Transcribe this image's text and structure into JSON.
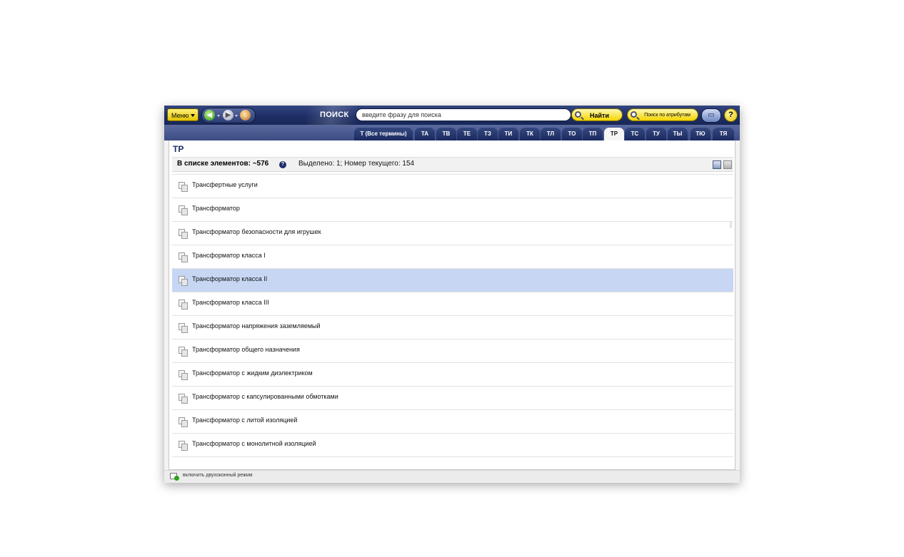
{
  "toolbar": {
    "menu_label": "Меню",
    "search_label": "ПОИСК",
    "search_placeholder": "введите фразу для поиска",
    "find_label": "Найти",
    "attr_search_label": "Поиск по атрибутам",
    "help_label": "?"
  },
  "tabs": [
    {
      "label": "Т (Все термины)",
      "active": false
    },
    {
      "label": "ТА",
      "active": false
    },
    {
      "label": "ТВ",
      "active": false
    },
    {
      "label": "ТЕ",
      "active": false
    },
    {
      "label": "ТЗ",
      "active": false
    },
    {
      "label": "ТИ",
      "active": false
    },
    {
      "label": "ТК",
      "active": false
    },
    {
      "label": "ТЛ",
      "active": false
    },
    {
      "label": "ТО",
      "active": false
    },
    {
      "label": "ТП",
      "active": false
    },
    {
      "label": "ТР",
      "active": true
    },
    {
      "label": "ТС",
      "active": false
    },
    {
      "label": "ТУ",
      "active": false
    },
    {
      "label": "ТЫ",
      "active": false
    },
    {
      "label": "ТЮ",
      "active": false
    },
    {
      "label": "ТЯ",
      "active": false
    }
  ],
  "list": {
    "title": "ТР",
    "count_text": "В списке элементов: ~576",
    "selection_text": "Выделено: 1; Номер текущего: 154",
    "items": [
      {
        "label": "Трансфертные услуги",
        "selected": false
      },
      {
        "label": "Трансформатор",
        "selected": false
      },
      {
        "label": "Трансформатор безопасности для игрушек",
        "selected": false
      },
      {
        "label": "Трансформатор класса I",
        "selected": false
      },
      {
        "label": "Трансформатор класса II",
        "selected": true
      },
      {
        "label": "Трансформатор класса III",
        "selected": false
      },
      {
        "label": "Трансформатор напряжения заземляемый",
        "selected": false
      },
      {
        "label": "Трансформатор общего назначения",
        "selected": false
      },
      {
        "label": "Трансформатор с жидким диэлектриком",
        "selected": false
      },
      {
        "label": "Трансформатор с капсулированными обмотками",
        "selected": false
      },
      {
        "label": "Трансформатор с литой изоляцией",
        "selected": false
      },
      {
        "label": "Трансформатор с монолитной изоляцией",
        "selected": false
      }
    ]
  },
  "footer": {
    "dual_window_label": "включить двухоконный режим"
  }
}
